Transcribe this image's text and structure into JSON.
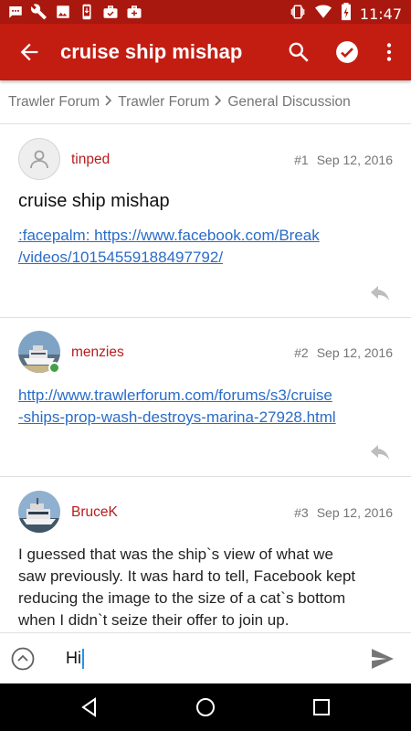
{
  "status_bar": {
    "time": "11:47",
    "left_icons": [
      "chat-bubble-icon",
      "wrench-icon",
      "image-icon",
      "phone-download-icon",
      "briefcase-check-icon",
      "briefcase-plus-icon"
    ],
    "right_icons": [
      "vibrate-icon",
      "wifi-icon",
      "battery-charging-icon"
    ]
  },
  "app_bar": {
    "title": "cruise ship mishap",
    "accent_color": "#c31d12",
    "actions": [
      "search-icon",
      "check-circle-icon",
      "more-vert-icon"
    ]
  },
  "breadcrumbs": [
    "Trawler Forum",
    "Trawler Forum",
    "General Discussion"
  ],
  "posts": [
    {
      "author": "tinped",
      "number": "#1",
      "date": "Sep 12, 2016",
      "title": "cruise ship mishap",
      "link_line1": ":facepalm: https://www.facebook.com/Break",
      "link_line2": "/videos/10154559188497792/",
      "avatar": "default-user-icon"
    },
    {
      "author": "menzies",
      "number": "#2",
      "date": "Sep 12, 2016",
      "link_line1": "http://www.trawlerforum.com/forums/s3/cruise",
      "link_line2": "-ships-prop-wash-destroys-marina-27928.html",
      "avatar": "boat-photo",
      "online": true
    },
    {
      "author": "BruceK",
      "number": "#3",
      "date": "Sep 12, 2016",
      "text_lines": [
        "I guessed that was the ship`s view of what we",
        "saw previously. It was hard to tell, Facebook kept",
        "reducing the image to the size of a cat`s bottom",
        "when I didn`t seize their offer to join up."
      ],
      "avatar": "boat-photo"
    }
  ],
  "composer": {
    "value": "Hi"
  },
  "nav_bar": [
    "back-icon",
    "home-icon",
    "recents-icon"
  ]
}
